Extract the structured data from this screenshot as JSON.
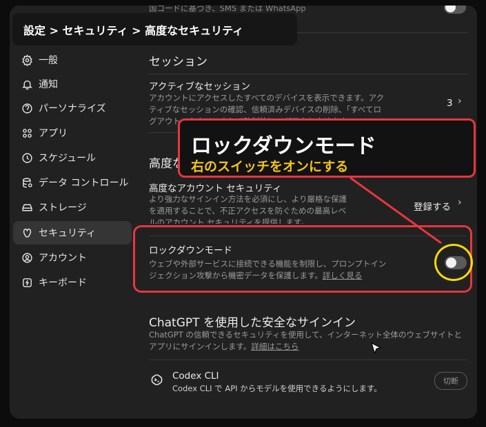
{
  "breadcrumb": "設定 > セキュリティ > 高度なセキュリティ",
  "sidebar": {
    "items": [
      {
        "label": "一般",
        "icon": "gear-icon"
      },
      {
        "label": "通知",
        "icon": "bell-icon"
      },
      {
        "label": "パーソナライズ",
        "icon": "personalize-icon"
      },
      {
        "label": "アプリ",
        "icon": "apps-icon"
      },
      {
        "label": "スケジュール",
        "icon": "clock-icon"
      },
      {
        "label": "データ コントロール",
        "icon": "database-icon"
      },
      {
        "label": "ストレージ",
        "icon": "storage-icon"
      },
      {
        "label": "セキュリティ",
        "icon": "shield-icon"
      },
      {
        "label": "アカウント",
        "icon": "user-icon"
      },
      {
        "label": "キーボード",
        "icon": "keyboard-icon"
      }
    ]
  },
  "top_partial": "国コードに基づき、SMS または WhatsApp",
  "sessions": {
    "title": "セッション",
    "active_title": "アクティブなセッション",
    "active_desc": "アカウントにアクセスしたすべてのデバイスを表示できます。アクティブなセッションの確認、信頼済みデバイスの削除、「すべてログアウト」をクリックして強制的にログアウトさせます。",
    "active_count": "3"
  },
  "advanced": {
    "title": "高度なセキュリティ",
    "account_title": "高度なアカウント セキュリティ",
    "account_desc": "より強力なサインイン方法を必須にし、より厳格な保護を適用することで、不正アクセスを防ぐための最高レベルのアカウント セキュリティを提供します。",
    "register_label": "登録する"
  },
  "lockdown": {
    "title": "ロックダウンモード",
    "desc": "ウェブや外部サービスに接続できる機能を制限し、プロンプトインジェクション攻撃から機密データを保護します。",
    "link": "詳しく見る",
    "enabled": false
  },
  "signin": {
    "title": "ChatGPT を使用した安全なサインイン",
    "desc": "ChatGPT の信頼できるセキュリティを使用して、インターネット全体のウェブサイトとアプリにサインインします。",
    "link": "詳細はこちら"
  },
  "codex": {
    "title": "Codex CLI",
    "desc": "Codex CLI で API からモデルを使用できるようにします。",
    "button": "切断"
  },
  "callout": {
    "title": "ロックダウンモード",
    "subtitle": "右のスイッチをオンにする"
  },
  "colors": {
    "highlight_red": "#e8363f",
    "highlight_yellow": "#f5d90a",
    "callout_subtitle": "#f5c518"
  }
}
